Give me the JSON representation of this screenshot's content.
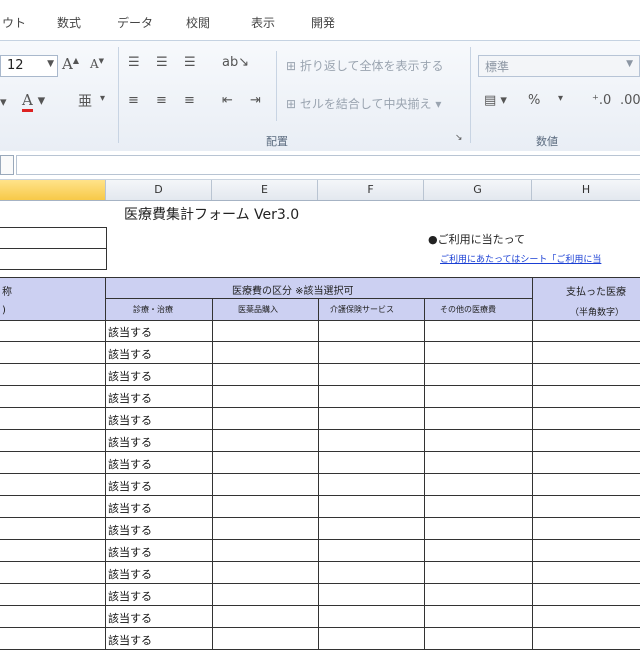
{
  "menu": {
    "tabs": [
      "ウト",
      "数式",
      "データ",
      "校閲",
      "表示",
      "開発"
    ]
  },
  "ribbon": {
    "font_size": "12",
    "grow_font": "A",
    "shrink_font": "A",
    "font_color": "A",
    "wrap_text": "折り返して全体を表示する",
    "merge_center": "セルを結合して中央揃え",
    "number_format": "標準",
    "percent": "%",
    "group_alignment": "配置",
    "group_number": "数値"
  },
  "columns": [
    "D",
    "E",
    "F",
    "G",
    "H"
  ],
  "sheet": {
    "title": "医療費集計フォーム Ver3.0",
    "notice_heading": "●ご利用に当たって",
    "notice_text": "ご利用にあたってはシート「ご利用に当",
    "left_header_top": "称",
    "left_header_bottom": ")",
    "category_header": "医療費の区分 ※該当選択可",
    "sub_headers": [
      "診療・治療",
      "医薬品購入",
      "介護保険サービス",
      "その他の医療費"
    ],
    "paid_header": "支払った医療",
    "paid_sub_header": "（半角数字）",
    "rows": [
      "該当する",
      "該当する",
      "該当する",
      "該当する",
      "該当する",
      "該当する",
      "該当する",
      "該当する",
      "該当する",
      "該当する",
      "該当する",
      "該当する",
      "該当する",
      "該当する",
      "該当する"
    ]
  },
  "colors": {
    "header_fill": "#ccd0f2",
    "selected_column": "#f7c948",
    "link": "#1a3fd4"
  }
}
